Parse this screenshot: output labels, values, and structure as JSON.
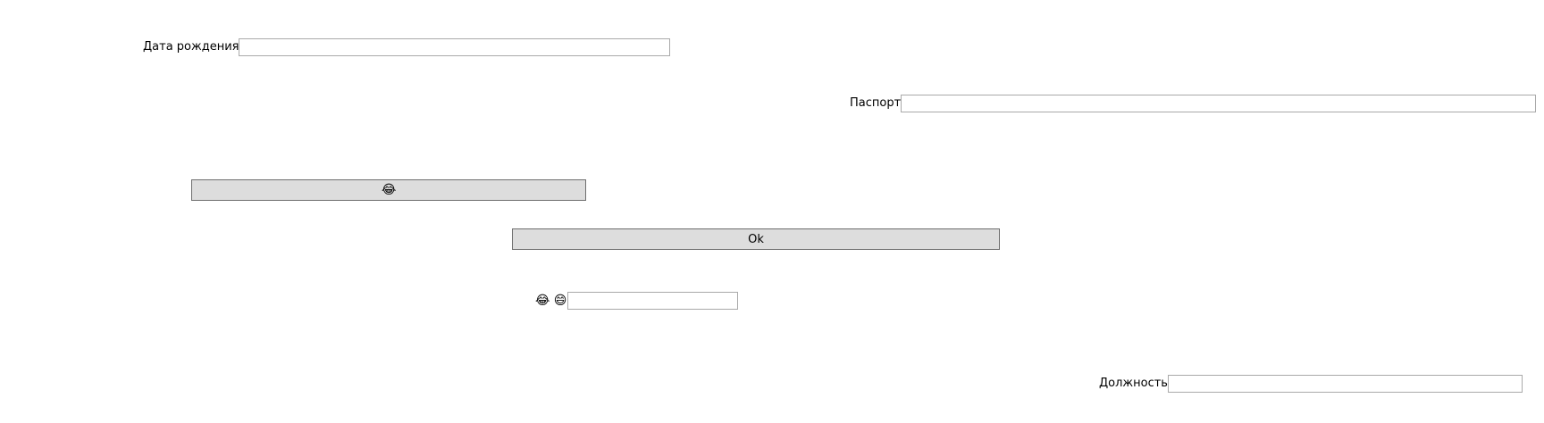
{
  "fields": {
    "birth_date": {
      "label": "Дата рождения",
      "value": ""
    },
    "passport": {
      "label": "Паспорт",
      "value": ""
    },
    "position": {
      "label": "Должность",
      "value": ""
    },
    "emoji_field": {
      "value": ""
    }
  },
  "buttons": {
    "emoji_button_glyph": "😂",
    "ok_label": "Ok"
  },
  "emoji_labels": {
    "first": "😂",
    "second": "😄"
  }
}
